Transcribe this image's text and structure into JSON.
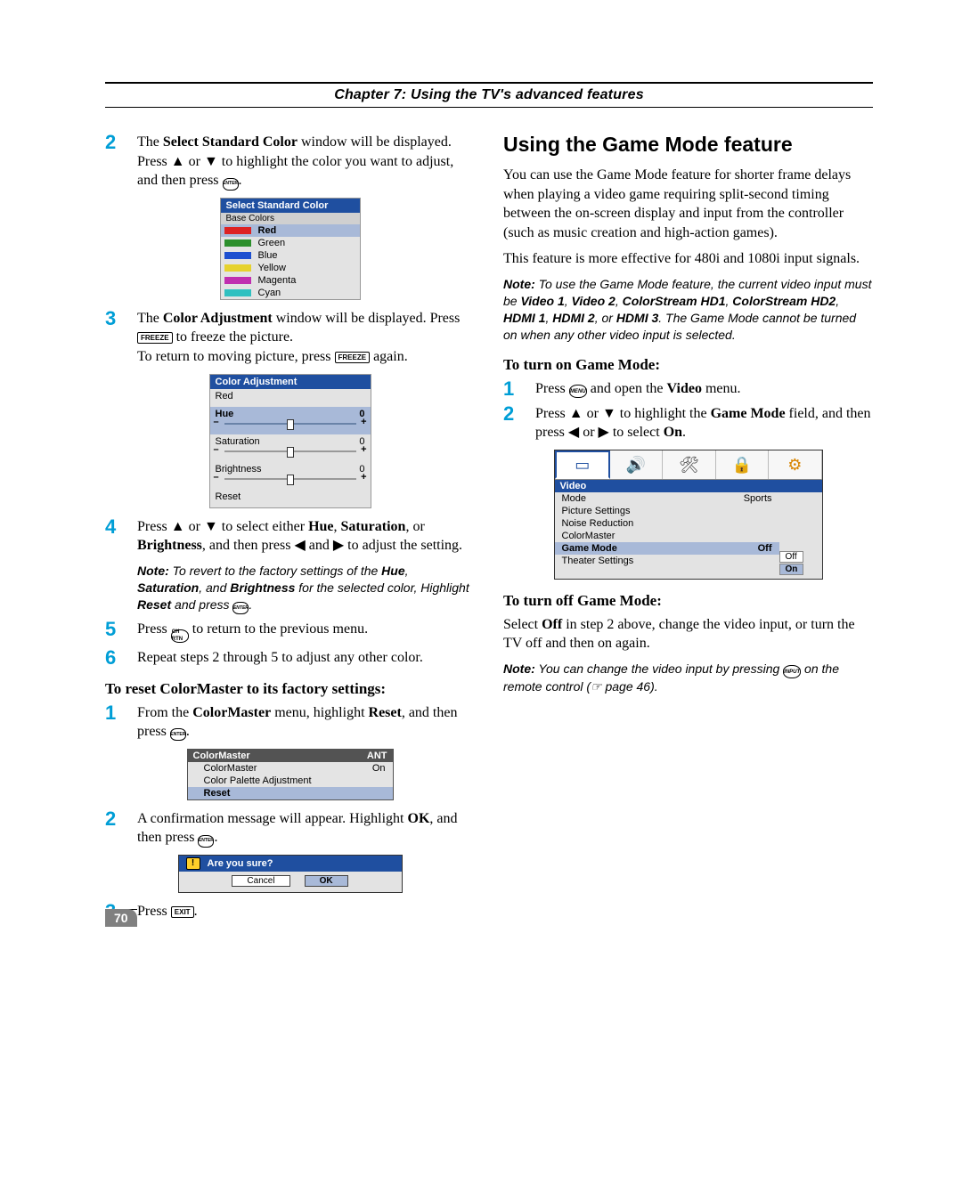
{
  "chapter": "Chapter 7: Using the TV's advanced features",
  "page_number": "70",
  "left": {
    "step2_a": "The ",
    "step2_b": "Select Standard Color",
    "step2_c": " window will be displayed. Press ▲ or ▼ to highlight the color you want to adjust, and then press ",
    "step3_a": "The ",
    "step3_b": "Color Adjustment",
    "step3_c": " window will be displayed. Press ",
    "step3_d": " to freeze the picture.",
    "step3_e": "To return to moving picture, press ",
    "step3_f": " again.",
    "step4_a": "Press ▲ or ▼ to select either ",
    "step4_b": "Hue",
    "step4_c": ", ",
    "step4_d": "Saturation",
    "step4_e": ", or ",
    "step4_f": "Brightness",
    "step4_g": ", and then press ◀ and ▶ to adjust the setting.",
    "note1_label": "Note:",
    "note1_a": " To revert to the factory settings of the ",
    "note1_b": "Hue",
    "note1_c": ", ",
    "note1_d": "Saturation",
    "note1_e": ", and ",
    "note1_f": "Brightness",
    "note1_g": " for the selected color, Highlight ",
    "note1_h": "Reset",
    "note1_i": " and press ",
    "step5_a": "Press ",
    "step5_b": " to return to the previous menu.",
    "step6": "Repeat steps 2 through 5 to adjust any other color.",
    "subhead": "To reset ColorMaster to its factory settings:",
    "r1_a": "From the ",
    "r1_b": "ColorMaster",
    "r1_c": " menu, highlight ",
    "r1_d": "Reset",
    "r1_e": ", and then press ",
    "r2_a": "A confirmation message will appear. Highlight ",
    "r2_b": "OK",
    "r2_c": ", and then press ",
    "r3_a": "Press ",
    "btn_freeze": "FREEZE",
    "btn_menu": "MENU",
    "btn_exit": "EXIT",
    "btn_enter": "ENTER",
    "btn_chrtn": "CH RTN",
    "btn_input": "INPUT",
    "scw": {
      "title": "Select Standard Color",
      "sub": "Base Colors",
      "rows": [
        "Red",
        "Green",
        "Blue",
        "Yellow",
        "Magenta",
        "Cyan"
      ]
    },
    "adj": {
      "title": "Color Adjustment",
      "rows": [
        "Red",
        "Hue",
        "Saturation",
        "Brightness",
        "Reset"
      ],
      "zero": "0"
    },
    "cm": {
      "title": "ColorMaster",
      "ant": "ANT",
      "rows": [
        "ColorMaster",
        "Color Palette Adjustment",
        "Reset"
      ],
      "on": "On"
    },
    "confirm": {
      "title": "Are you sure?",
      "cancel": "Cancel",
      "ok": "OK"
    }
  },
  "right": {
    "heading": "Using the Game Mode feature",
    "p1": "You can use the Game Mode feature for shorter frame delays when playing a video game requiring split-second timing between the on-screen display and input from the controller (such as music creation and high-action games).",
    "p2": "This feature is more effective for 480i and 1080i input signals.",
    "note1_label": "Note:",
    "note1_a": " To use the Game Mode feature, the current video input must be ",
    "note1_v1": "Video 1",
    "note1_s1": ", ",
    "note1_v2": "Video 2",
    "note1_s2": ", ",
    "note1_v3": "ColorStream HD1",
    "note1_s3": ", ",
    "note1_v4": "ColorStream HD2",
    "note1_s4": ", ",
    "note1_v5": "HDMI 1",
    "note1_s5": ", ",
    "note1_v6": "HDMI 2",
    "note1_s6": ", or ",
    "note1_v7": "HDMI 3",
    "note1_b": ". The Game Mode cannot be turned on when any other video input is selected.",
    "sub_on": "To turn on Game Mode:",
    "s1_a": "Press ",
    "s1_b": " and open the ",
    "s1_c": "Video",
    "s1_d": " menu.",
    "s2_a": "Press ▲ or ▼ to highlight the ",
    "s2_b": "Game Mode",
    "s2_c": " field, and then press ◀ or ▶ to select ",
    "s2_d": "On",
    "s2_e": ".",
    "sub_off": "To turn off Game Mode:",
    "off_a": "Select ",
    "off_b": "Off",
    "off_c": " in step 2 above, change the video input, or turn the TV off and then on again.",
    "note2_label": "Note:",
    "note2_a": " You can change the video input by pressing ",
    "note2_b": " on the remote control (☞ page 46).",
    "menu": {
      "section": "Video",
      "rows": [
        {
          "l": "Mode",
          "r": "Sports"
        },
        {
          "l": "Picture Settings",
          "r": ""
        },
        {
          "l": "Noise Reduction",
          "r": ""
        },
        {
          "l": "ColorMaster",
          "r": ""
        },
        {
          "l": "Game Mode",
          "r": "Off"
        },
        {
          "l": "Theater Settings",
          "r": ""
        }
      ],
      "opts": [
        "Off",
        "On"
      ]
    }
  }
}
